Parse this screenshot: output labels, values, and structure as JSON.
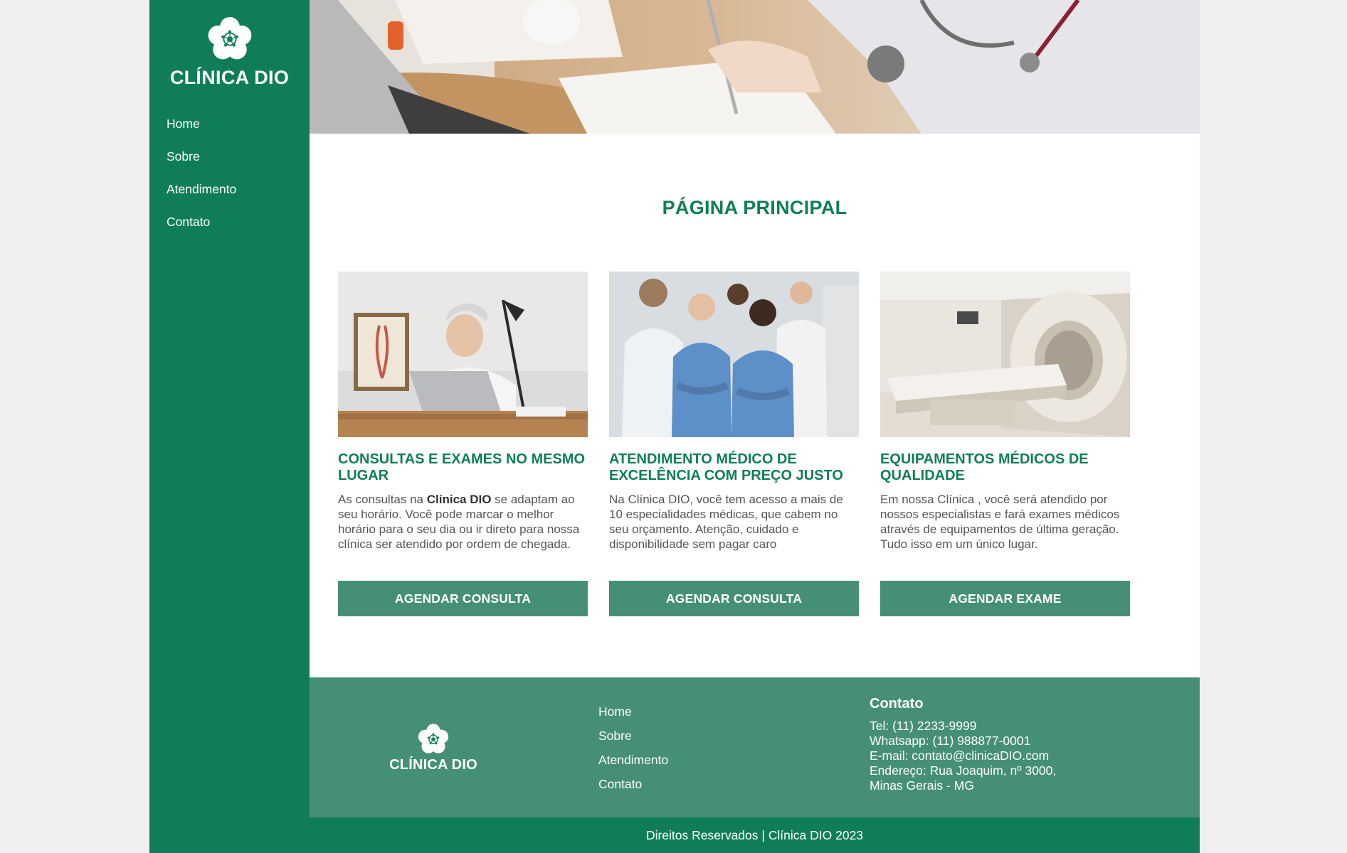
{
  "sidebar": {
    "brand_name": "CLÍNICA DIO",
    "logo_icon": "flower-icon",
    "nav": [
      {
        "label": "Home"
      },
      {
        "label": "Sobre"
      },
      {
        "label": "Atendimento"
      },
      {
        "label": "Contato"
      }
    ]
  },
  "hero": {
    "image": "doctor-writing-photo"
  },
  "main": {
    "title": "PÁGINA PRINCIPAL",
    "cards": [
      {
        "image": "doctor-at-laptop-photo",
        "title": "CONSULTAS E EXAMES NO MESMO LUGAR",
        "text_before": "As consultas na ",
        "text_bold": "Clínica DIO",
        "text_after": " se adaptam ao seu horário. Você pode marcar o melhor horário para o seu dia ou ir direto para nossa clínica ser atendido por ordem de chegada.",
        "button": "AGENDAR CONSULTA"
      },
      {
        "image": "medical-team-photo",
        "title": "ATENDIMENTO MÉDICO DE EXCELÊNCIA COM PREÇO JUSTO",
        "text": "Na Clínica DIO, você tem acesso a mais de 10 especialidades médicas, que cabem no seu orçamento. Atenção, cuidado e disponibilidade sem pagar caro",
        "button": "AGENDAR CONSULTA"
      },
      {
        "image": "mri-scanner-photo",
        "title": "EQUIPAMENTOS MÉDICOS DE QUALIDADE",
        "text": "Em nossa Clínica , você será atendido por nossos especialistas e fará exames médicos através de equipamentos de última geração. Tudo isso em um único lugar.",
        "button": "AGENDAR EXAME"
      }
    ]
  },
  "footer": {
    "brand_name": "CLÍNICA DIO",
    "nav": [
      {
        "label": "Home"
      },
      {
        "label": "Sobre"
      },
      {
        "label": "Atendimento"
      },
      {
        "label": "Contato"
      }
    ],
    "contact": {
      "heading": "Contato",
      "lines": [
        "Tel: (11) 2233-9999",
        "Whatsapp: (11) 988877-0001",
        "E-mail: contato@clinicaDIO.com",
        "Endereço: Rua Joaquim, nº 3000,",
        "Minas Gerais - MG"
      ]
    },
    "copyright": "Direitos Reservados | Clínica DIO 2023"
  },
  "colors": {
    "brand_green": "#0f7e58",
    "button_green": "#458f76",
    "page_bg": "#efefef"
  }
}
